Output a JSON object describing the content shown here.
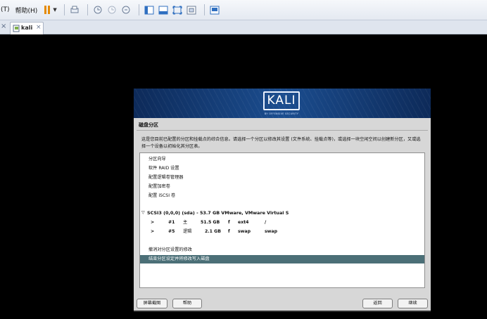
{
  "toolbar": {
    "menus": [
      "(T)",
      "帮助(H)"
    ]
  },
  "tabs": [
    {
      "label": "kali"
    }
  ],
  "installer": {
    "logo_text": "KALI",
    "logo_tagline": "BY OFFENSIVE SECURITY",
    "section_title": "磁盘分区",
    "description": "这是您目前已配置的分区和挂载点的综合信息。请选择一个分区以修改其设置 (文件系统、挂载点等)，或选择一块空闲空间以创建新分区，又或选择一个设备以初始化其分区表。",
    "menu_items": [
      {
        "label": "分区向导"
      },
      {
        "label": "软件 RAID 设置"
      },
      {
        "label": "配置逻辑卷管理器"
      },
      {
        "label": "配置加密卷"
      },
      {
        "label": "配置 iSCSI 卷"
      }
    ],
    "disk": {
      "expander": "▽",
      "label": "SCSI3 (0,0,0) (sda) - 53.7 GB VMware, VMware Virtual S"
    },
    "partitions": [
      {
        "arrow": ">",
        "number": "#1",
        "type": "主",
        "size": "51.5 GB",
        "flag": "f",
        "fs": "ext4",
        "mount": "/"
      },
      {
        "arrow": ">",
        "number": "#5",
        "type": "逻辑",
        "size": "2.1 GB",
        "flag": "f",
        "fs": "swap",
        "mount": "swap"
      }
    ],
    "undo_label": "撤消对分区设置的修改",
    "finish_label": "结束分区设定并将修改写入磁盘",
    "buttons": {
      "screenshot": "屏幕截图",
      "help": "帮助",
      "back": "返回",
      "continue": "继续"
    }
  },
  "colors": {
    "banner": "#1b4d8f",
    "selection": "#4b6f77",
    "pause_accent": "#e58a00"
  }
}
